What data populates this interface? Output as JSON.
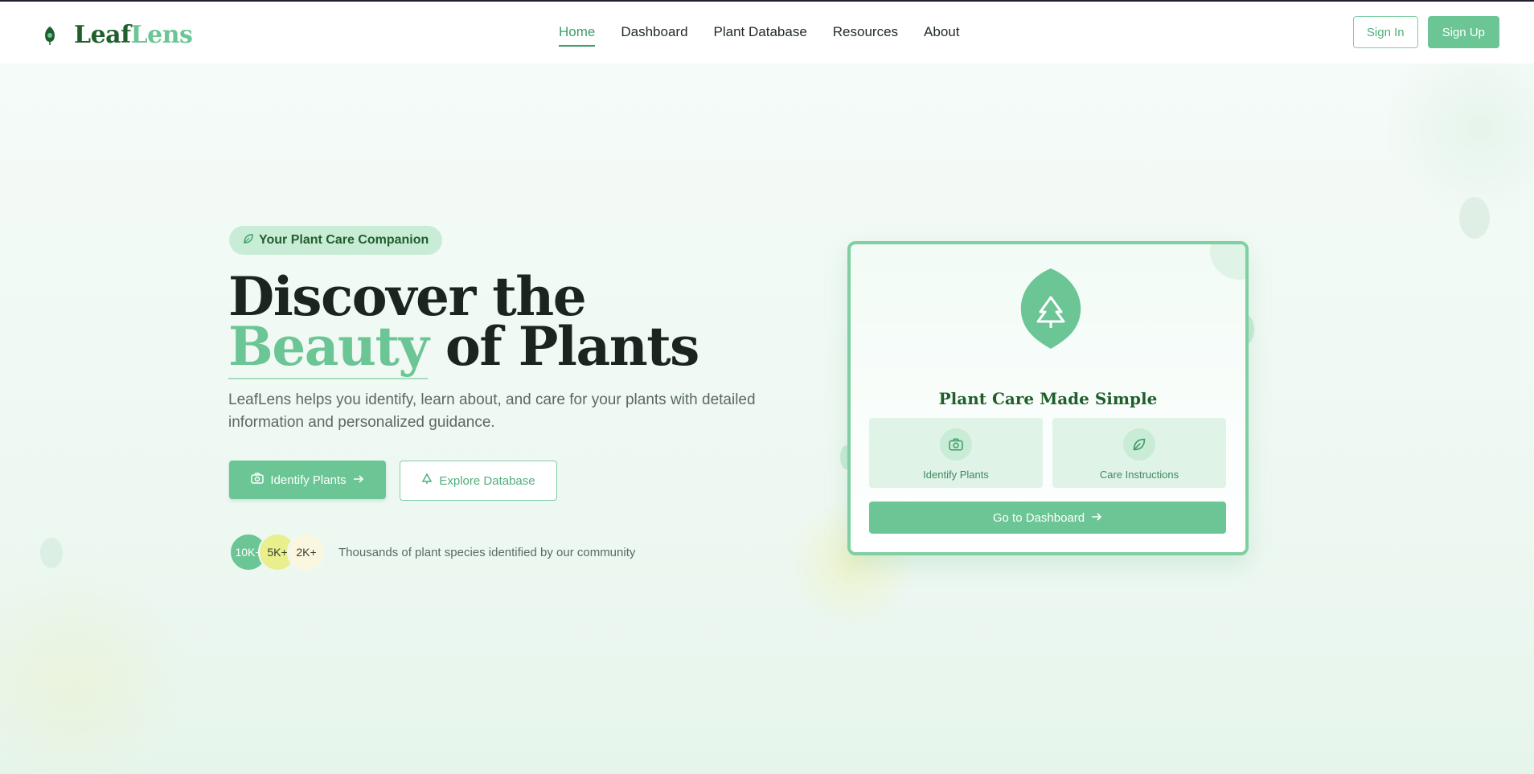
{
  "brand": {
    "name_part1": "Leaf",
    "name_part2": "Lens"
  },
  "nav": {
    "items": [
      {
        "label": "Home",
        "active": true
      },
      {
        "label": "Dashboard",
        "active": false
      },
      {
        "label": "Plant Database",
        "active": false
      },
      {
        "label": "Resources",
        "active": false
      },
      {
        "label": "About",
        "active": false
      }
    ]
  },
  "auth": {
    "sign_in": "Sign In",
    "sign_up": "Sign Up"
  },
  "hero": {
    "badge": "Your Plant Care Companion",
    "headline_before": "Discover the ",
    "headline_accent": "Beauty",
    "headline_after": " of Plants",
    "subtitle": "LeafLens helps you identify, learn about, and care for your plants with detailed information and personalized guidance.",
    "primary_cta": "Identify Plants",
    "secondary_cta": "Explore Database",
    "stats": [
      "10K+",
      "5K+",
      "2K+"
    ],
    "stats_caption": "Thousands of plant species identified by our community"
  },
  "card": {
    "title": "Plant Care Made Simple",
    "features": [
      {
        "label": "Identify Plants",
        "icon": "camera-icon"
      },
      {
        "label": "Care Instructions",
        "icon": "leaf-icon"
      }
    ],
    "cta": "Go to Dashboard"
  },
  "colors": {
    "accent": "#6cc594",
    "brand_dark": "#1f5f2c",
    "active_nav": "#3f9d68",
    "stat_yellow": "#e9ef8c",
    "stat_cream": "#fbf6df"
  }
}
